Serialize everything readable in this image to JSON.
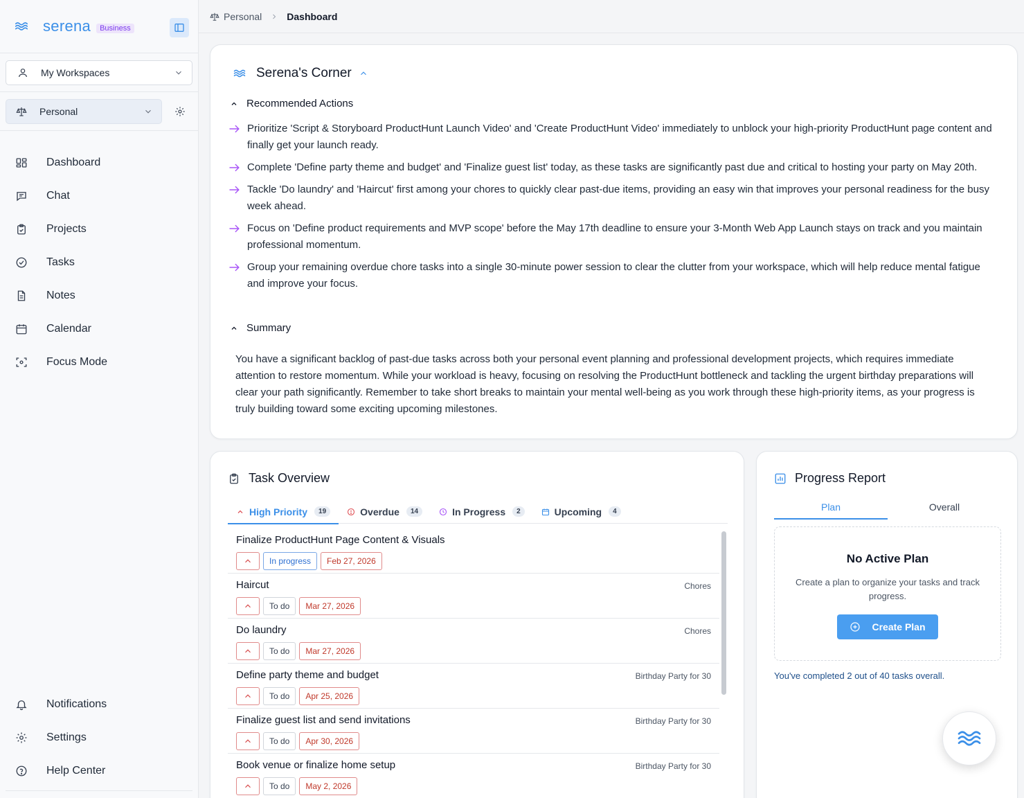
{
  "brand": {
    "name": "serena",
    "badge": "Business"
  },
  "sidebar": {
    "workspace_select": "My Workspaces",
    "space_select": "Personal",
    "nav": [
      {
        "label": "Dashboard",
        "icon": "dashboard-icon"
      },
      {
        "label": "Chat",
        "icon": "chat-icon"
      },
      {
        "label": "Projects",
        "icon": "projects-icon"
      },
      {
        "label": "Tasks",
        "icon": "tasks-icon"
      },
      {
        "label": "Notes",
        "icon": "notes-icon"
      },
      {
        "label": "Calendar",
        "icon": "calendar-icon"
      },
      {
        "label": "Focus Mode",
        "icon": "focus-icon"
      }
    ],
    "bottom_nav": [
      {
        "label": "Notifications",
        "icon": "bell-icon"
      },
      {
        "label": "Settings",
        "icon": "gear-icon"
      },
      {
        "label": "Help Center",
        "icon": "help-icon"
      }
    ]
  },
  "breadcrumb": {
    "root": "Personal",
    "current": "Dashboard"
  },
  "corner": {
    "title": "Serena's Corner",
    "actions_heading": "Recommended Actions",
    "actions": [
      "Prioritize 'Script & Storyboard ProductHunt Launch Video' and 'Create ProductHunt Video' immediately to unblock your high-priority ProductHunt page content and finally get your launch ready.",
      "Complete 'Define party theme and budget' and 'Finalize guest list' today, as these tasks are significantly past due and critical to hosting your party on May 20th.",
      "Tackle 'Do laundry' and 'Haircut' first among your chores to quickly clear past-due items, providing an easy win that improves your personal readiness for the busy week ahead.",
      "Focus on 'Define product requirements and MVP scope' before the May 17th deadline to ensure your 3-Month Web App Launch stays on track and you maintain professional momentum.",
      "Group your remaining overdue chore tasks into a single 30-minute power session to clear the clutter from your workspace, which will help reduce mental fatigue and improve your focus."
    ],
    "summary_heading": "Summary",
    "summary": "You have a significant backlog of past-due tasks across both your personal event planning and professional development projects, which requires immediate attention to restore momentum. While your workload is heavy, focusing on resolving the ProductHunt bottleneck and tackling the urgent birthday preparations will clear your path significantly. Remember to take short breaks to maintain your mental well-being as you work through these high-priority items, as your progress is truly building toward some exciting upcoming milestones."
  },
  "task_overview": {
    "title": "Task Overview",
    "tabs": [
      {
        "label": "High Priority",
        "count": "19"
      },
      {
        "label": "Overdue",
        "count": "14"
      },
      {
        "label": "In Progress",
        "count": "2"
      },
      {
        "label": "Upcoming",
        "count": "4"
      }
    ],
    "tasks": [
      {
        "title": "Finalize ProductHunt Page Content & Visuals",
        "project": "",
        "status": "In progress",
        "date": "Feb 27, 2026"
      },
      {
        "title": "Haircut",
        "project": "Chores",
        "status": "To do",
        "date": "Mar 27, 2026"
      },
      {
        "title": "Do laundry",
        "project": "Chores",
        "status": "To do",
        "date": "Mar 27, 2026"
      },
      {
        "title": "Define party theme and budget",
        "project": "Birthday Party for 30",
        "status": "To do",
        "date": "Apr 25, 2026"
      },
      {
        "title": "Finalize guest list and send invitations",
        "project": "Birthday Party for 30",
        "status": "To do",
        "date": "Apr 30, 2026"
      },
      {
        "title": "Book venue or finalize home setup",
        "project": "Birthday Party for 30",
        "status": "To do",
        "date": "May 2, 2026"
      }
    ]
  },
  "progress": {
    "title": "Progress Report",
    "tabs": [
      "Plan",
      "Overall"
    ],
    "empty_title": "No Active Plan",
    "empty_desc": "Create a plan to organize your tasks and track progress.",
    "create_label": "Create Plan",
    "completed_text": "You've completed 2 out of 40 tasks overall."
  },
  "colors": {
    "accent": "#3b8fe8",
    "danger": "#c0392b",
    "arrow": "#a855f7"
  }
}
